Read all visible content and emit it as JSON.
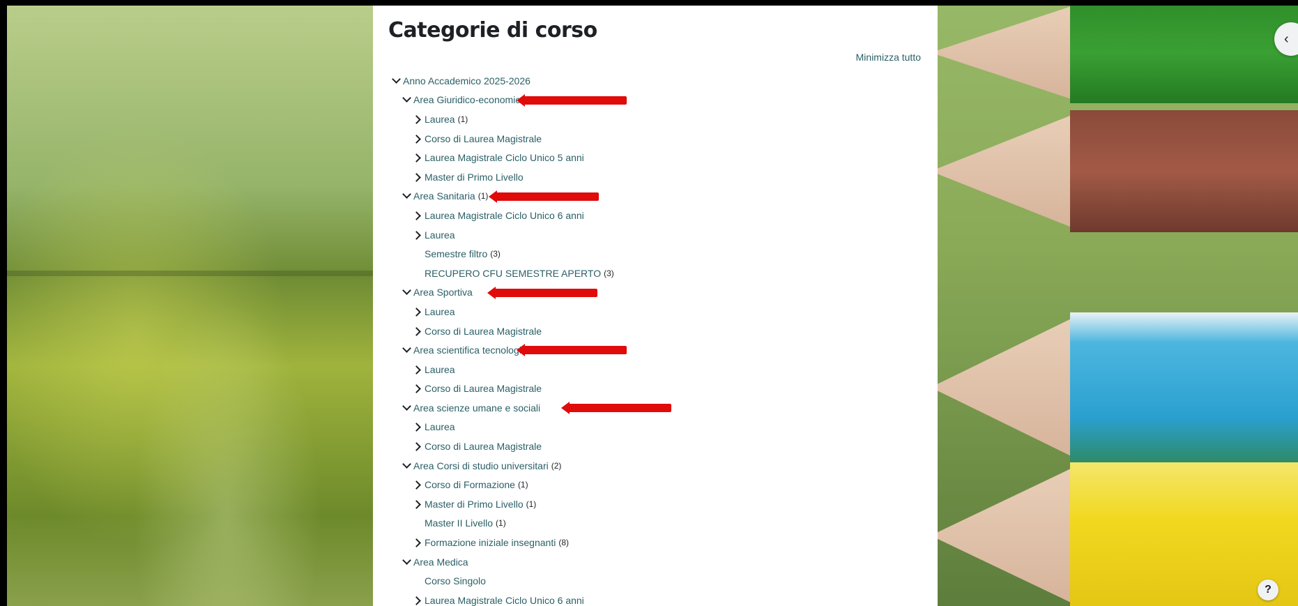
{
  "page": {
    "title": "Categorie di corso",
    "collapse_all": "Minimizza tutto"
  },
  "tree": [
    {
      "level": 0,
      "state": "expanded",
      "label": "Anno Accademico 2025-2026",
      "count": ""
    },
    {
      "level": 1,
      "state": "expanded",
      "label": "Area Giuridico-economica",
      "count": "",
      "highlighted": true
    },
    {
      "level": 2,
      "state": "collapsed",
      "label": "Laurea",
      "count": "(1)"
    },
    {
      "level": 2,
      "state": "collapsed",
      "label": "Corso di Laurea Magistrale",
      "count": ""
    },
    {
      "level": 2,
      "state": "collapsed",
      "label": "Laurea Magistrale Ciclo Unico 5 anni",
      "count": ""
    },
    {
      "level": 2,
      "state": "collapsed",
      "label": "Master di Primo Livello",
      "count": ""
    },
    {
      "level": 1,
      "state": "expanded",
      "label": "Area Sanitaria",
      "count": "(1)",
      "highlighted": true
    },
    {
      "level": 2,
      "state": "collapsed",
      "label": "Laurea Magistrale Ciclo Unico 6 anni",
      "count": ""
    },
    {
      "level": 2,
      "state": "collapsed",
      "label": "Laurea",
      "count": ""
    },
    {
      "level": 2,
      "state": "none",
      "label": "Semestre filtro",
      "count": "(3)"
    },
    {
      "level": 2,
      "state": "none",
      "label": "RECUPERO CFU SEMESTRE APERTO",
      "count": "(3)"
    },
    {
      "level": 1,
      "state": "expanded",
      "label": "Area Sportiva",
      "count": "",
      "highlighted": true
    },
    {
      "level": 2,
      "state": "collapsed",
      "label": "Laurea",
      "count": ""
    },
    {
      "level": 2,
      "state": "collapsed",
      "label": "Corso di Laurea Magistrale",
      "count": ""
    },
    {
      "level": 1,
      "state": "expanded",
      "label": "Area scientifica tecnologica",
      "count": "",
      "highlighted": true
    },
    {
      "level": 2,
      "state": "collapsed",
      "label": "Laurea",
      "count": ""
    },
    {
      "level": 2,
      "state": "collapsed",
      "label": "Corso di Laurea Magistrale",
      "count": ""
    },
    {
      "level": 1,
      "state": "expanded",
      "label": "Area scienze umane e sociali",
      "count": "",
      "highlighted": true
    },
    {
      "level": 2,
      "state": "collapsed",
      "label": "Laurea",
      "count": ""
    },
    {
      "level": 2,
      "state": "collapsed",
      "label": "Corso di Laurea Magistrale",
      "count": ""
    },
    {
      "level": 1,
      "state": "expanded",
      "label": "Area Corsi di studio universitari",
      "count": "(2)"
    },
    {
      "level": 2,
      "state": "collapsed",
      "label": "Corso di Formazione",
      "count": "(1)"
    },
    {
      "level": 2,
      "state": "collapsed",
      "label": "Master di Primo Livello",
      "count": "(1)"
    },
    {
      "level": 2,
      "state": "none",
      "label": "Master II Livello",
      "count": "(1)"
    },
    {
      "level": 2,
      "state": "collapsed",
      "label": "Formazione iniziale insegnanti",
      "count": "(8)"
    },
    {
      "level": 1,
      "state": "expanded",
      "label": "Area Medica",
      "count": ""
    },
    {
      "level": 2,
      "state": "none",
      "label": "Corso Singolo",
      "count": ""
    },
    {
      "level": 2,
      "state": "collapsed",
      "label": "Laurea Magistrale Ciclo Unico 6 anni",
      "count": ""
    }
  ],
  "controls": {
    "drawer_toggle_icon": "‹",
    "help_icon": "?"
  },
  "colors": {
    "link": "#2a5f66",
    "annotation_arrow": "#e00b0b"
  }
}
